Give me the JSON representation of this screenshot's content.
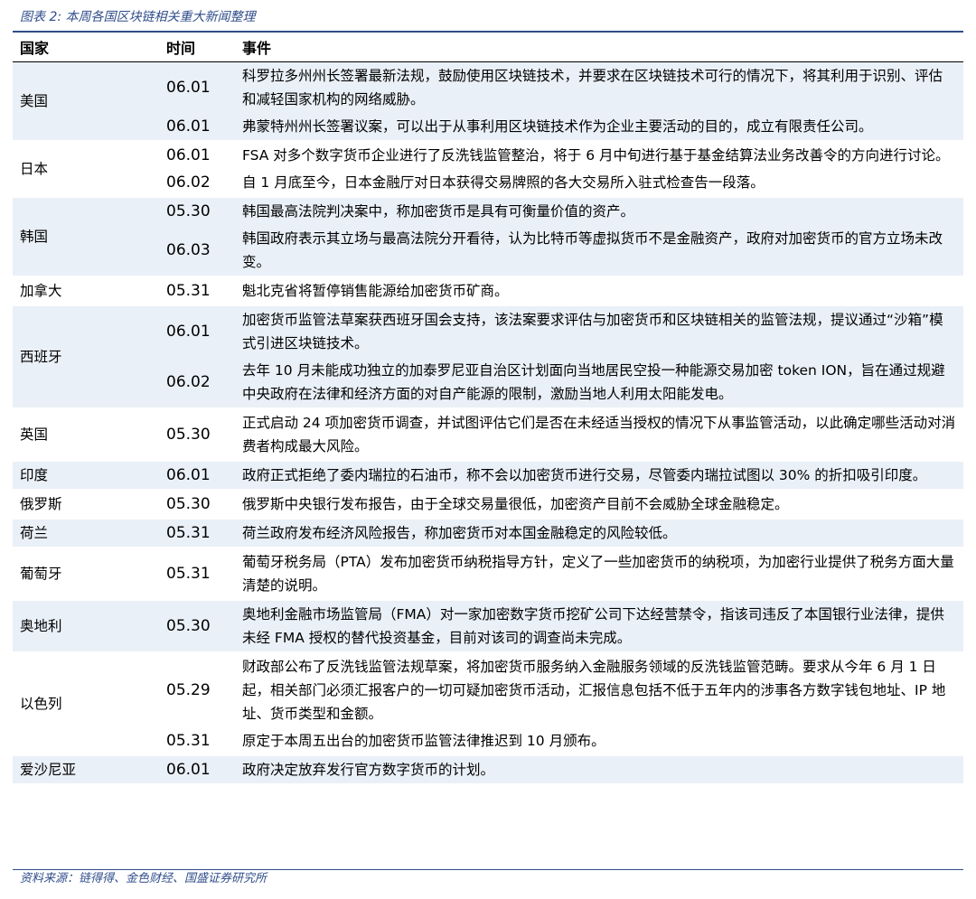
{
  "title": "图表 2:  本周各国区块链相关重大新闻整理",
  "headers": {
    "country": "国家",
    "date": "时间",
    "event": "事件"
  },
  "groups": [
    {
      "country": "美国",
      "rows": [
        {
          "date": "06.01",
          "event": "科罗拉多州州长签署最新法规，鼓励使用区块链技术，并要求在区块链技术可行的情况下，将其利用于识别、评估和减轻国家机构的网络威胁。"
        },
        {
          "date": "06.01",
          "event": "弗蒙特州州长签署议案，可以出于从事利用区块链技术作为企业主要活动的目的，成立有限责任公司。"
        }
      ]
    },
    {
      "country": "日本",
      "rows": [
        {
          "date": "06.01",
          "event": "FSA 对多个数字货币企业进行了反洗钱监管整治，将于 6 月中旬进行基于基金结算法业务改善令的方向进行讨论。"
        },
        {
          "date": "06.02",
          "event": "自 1 月底至今，日本金融厅对日本获得交易牌照的各大交易所入驻式检查告一段落。"
        }
      ]
    },
    {
      "country": "韩国",
      "rows": [
        {
          "date": "05.30",
          "event": "韩国最高法院判决案中，称加密货币是具有可衡量价值的资产。"
        },
        {
          "date": "06.03",
          "event": "韩国政府表示其立场与最高法院分开看待，认为比特币等虚拟货币不是金融资产，政府对加密货币的官方立场未改变。"
        }
      ]
    },
    {
      "country": "加拿大",
      "rows": [
        {
          "date": "05.31",
          "event": "魁北克省将暂停销售能源给加密货币矿商。"
        }
      ]
    },
    {
      "country": "西班牙",
      "rows": [
        {
          "date": "06.01",
          "event": "加密货币监管法草案获西班牙国会支持，该法案要求评估与加密货币和区块链相关的监管法规，提议通过“沙箱”模式引进区块链技术。"
        },
        {
          "date": "06.02",
          "event": "去年 10 月未能成功独立的加泰罗尼亚自治区计划面向当地居民空投一种能源交易加密 token ION，旨在通过规避中央政府在法律和经济方面的对自产能源的限制，激励当地人利用太阳能发电。"
        }
      ]
    },
    {
      "country": "英国",
      "rows": [
        {
          "date": "05.30",
          "event": "正式启动 24 项加密货币调查，并试图评估它们是否在未经适当授权的情况下从事监管活动，以此确定哪些活动对消费者构成最大风险。"
        }
      ]
    },
    {
      "country": "印度",
      "rows": [
        {
          "date": "06.01",
          "event": "政府正式拒绝了委内瑞拉的石油币，称不会以加密货币进行交易，尽管委内瑞拉试图以 30% 的折扣吸引印度。"
        }
      ]
    },
    {
      "country": "俄罗斯",
      "rows": [
        {
          "date": "05.30",
          "event": "俄罗斯中央银行发布报告，由于全球交易量很低，加密资产目前不会威胁全球金融稳定。"
        }
      ]
    },
    {
      "country": "荷兰",
      "rows": [
        {
          "date": "05.31",
          "event": "荷兰政府发布经济风险报告，称加密货币对本国金融稳定的风险较低。"
        }
      ]
    },
    {
      "country": "葡萄牙",
      "rows": [
        {
          "date": "05.31",
          "event": "葡萄牙税务局（PTA）发布加密货币纳税指导方针，定义了一些加密货币的纳税项，为加密行业提供了税务方面大量清楚的说明。"
        }
      ]
    },
    {
      "country": "奥地利",
      "rows": [
        {
          "date": "05.30",
          "event": "奥地利金融市场监管局（FMA）对一家加密数字货币挖矿公司下达经营禁令，指该司违反了本国银行业法律，提供未经 FMA 授权的替代投资基金，目前对该司的调查尚未完成。"
        }
      ]
    },
    {
      "country": "以色列",
      "rows": [
        {
          "date": "05.29",
          "event": "财政部公布了反洗钱监管法规草案，将加密货币服务纳入金融服务领域的反洗钱监管范畴。要求从今年 6 月 1 日起，相关部门必须汇报客户的一切可疑加密货币活动，汇报信息包括不低于五年内的涉事各方数字钱包地址、IP 地址、货币类型和金额。"
        },
        {
          "date": "05.31",
          "event": "原定于本周五出台的加密货币监管法律推迟到 10 月颁布。"
        }
      ]
    },
    {
      "country": "爱沙尼亚",
      "rows": [
        {
          "date": "06.01",
          "event": "政府决定放弃发行官方数字货币的计划。"
        }
      ]
    }
  ],
  "source": "资料来源：链得得、金色财经、国盛证券研究所",
  "colors": {
    "accent": "#2f4d8b",
    "shade": "#eaf0f7"
  }
}
